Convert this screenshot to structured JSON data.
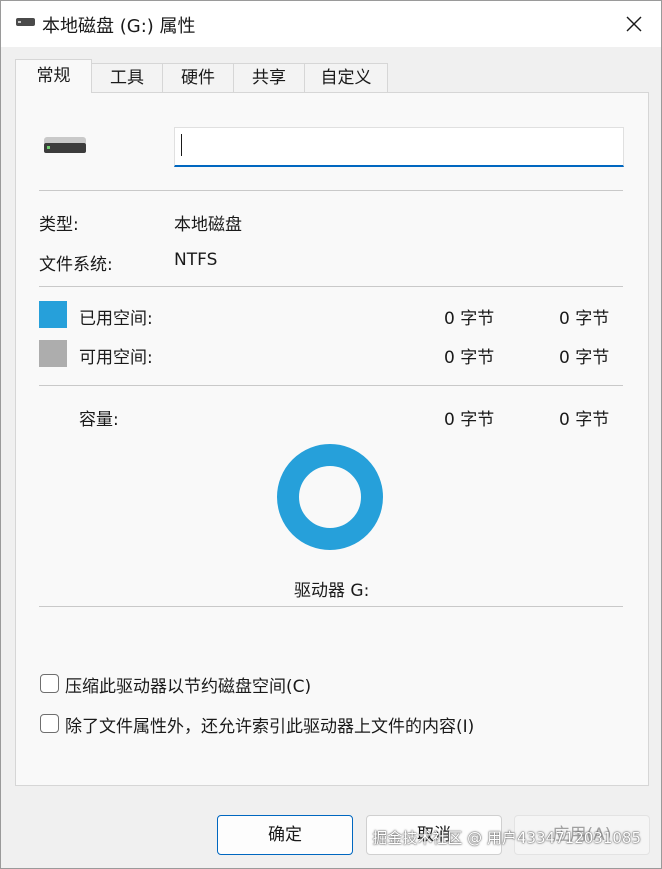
{
  "window": {
    "title": "本地磁盘 (G:) 属性",
    "icon": "drive-icon",
    "close_icon": "close-icon"
  },
  "tabs": [
    {
      "label": "常规",
      "active": true
    },
    {
      "label": "工具",
      "active": false
    },
    {
      "label": "硬件",
      "active": false
    },
    {
      "label": "共享",
      "active": false
    },
    {
      "label": "自定义",
      "active": false
    }
  ],
  "general": {
    "drive_name_value": "",
    "type_label": "类型:",
    "type_value": "本地磁盘",
    "fs_label": "文件系统:",
    "fs_value": "NTFS",
    "used_label": "已用空间:",
    "used_bytes": "0 字节",
    "used_size": "0 字节",
    "free_label": "可用空间:",
    "free_bytes": "0 字节",
    "free_size": "0 字节",
    "capacity_label": "容量:",
    "capacity_bytes": "0 字节",
    "capacity_size": "0 字节",
    "drive_label": "驱动器 G:",
    "used_color": "#26a0da",
    "free_color": "#adadad",
    "compress_label": "压缩此驱动器以节约磁盘空间(C)",
    "compress_checked": false,
    "index_label": "除了文件属性外，还允许索引此驱动器上文件的内容(I)",
    "index_checked": false
  },
  "buttons": {
    "ok": "确定",
    "cancel": "取消",
    "apply": "应用(A)"
  },
  "watermark": "掘金技术社区 @ 用户4334712031085"
}
